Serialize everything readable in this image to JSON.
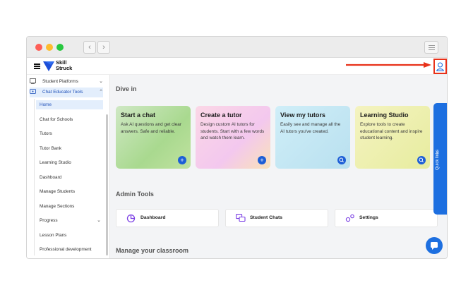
{
  "brand": {
    "line1": "Skill",
    "line2": "Struck"
  },
  "sidebar": {
    "groups": [
      {
        "label": "Student Platforms",
        "expanded": false
      },
      {
        "label": "Chat Educator Tools",
        "expanded": true
      }
    ],
    "items": [
      {
        "label": "Home",
        "active": true
      },
      {
        "label": "Chat for Schools"
      },
      {
        "label": "Tutors"
      },
      {
        "label": "Tutor Bank"
      },
      {
        "label": "Learning Studio"
      },
      {
        "label": "Dashboard"
      },
      {
        "label": "Manage Students"
      },
      {
        "label": "Manage Sections"
      },
      {
        "label": "Progress"
      },
      {
        "label": "Lesson Plans"
      },
      {
        "label": "Professional development"
      }
    ]
  },
  "main": {
    "dive_title": "Dive in",
    "cards": [
      {
        "title": "Start a chat",
        "desc": "Ask AI questions and get clear answers. Safe and reliable.",
        "action": "plus-icon"
      },
      {
        "title": "Create a tutor",
        "desc": "Design custom AI tutors for students. Start with a few words and watch them learn.",
        "action": "plus-icon"
      },
      {
        "title": "View my tutors",
        "desc": "Easily see and manage all the AI tutors you've created.",
        "action": "search-icon"
      },
      {
        "title": "Learning Studio",
        "desc": "Explore tools to create educational content and inspire student learning.",
        "action": "search-icon"
      }
    ],
    "admin_title": "Admin Tools",
    "admin_tools": [
      {
        "label": "Dashboard",
        "icon": "dashboard-icon"
      },
      {
        "label": "Student Chats",
        "icon": "chat-bubbles-icon"
      },
      {
        "label": "Settings",
        "icon": "settings-icon"
      }
    ],
    "classroom_title": "Manage your classroom"
  },
  "quick_links": {
    "label": "Quick links"
  },
  "colors": {
    "accent": "#1d6fe0",
    "highlight_red": "#e8311a",
    "active_bg": "#e3eefc"
  }
}
